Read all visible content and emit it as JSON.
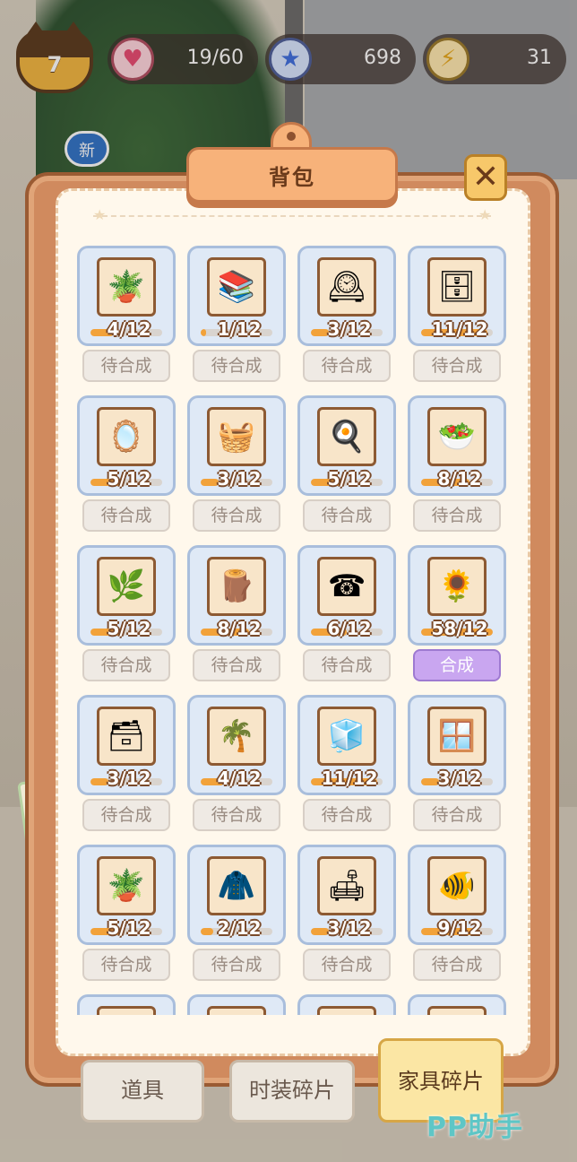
{
  "status": {
    "level": "7",
    "hearts": "19/60",
    "stars": "698",
    "energy": "31"
  },
  "side": {
    "new_badge": "新"
  },
  "panel": {
    "title": "背包",
    "close": "✕"
  },
  "items": [
    {
      "icon": "flower-pot-table",
      "glyph": "🪴",
      "count": "4/12",
      "progress": 0.33,
      "action": "待合成"
    },
    {
      "icon": "bookshelf",
      "glyph": "📚",
      "count": "1/12",
      "progress": 0.08,
      "action": "待合成"
    },
    {
      "icon": "cuckoo-clock",
      "glyph": "🕰",
      "count": "3/12",
      "progress": 0.25,
      "action": "待合成"
    },
    {
      "icon": "side-table",
      "glyph": "🗄",
      "count": "11/12",
      "progress": 0.92,
      "action": "待合成"
    },
    {
      "icon": "arched-mirror",
      "glyph": "🪞",
      "count": "5/12",
      "progress": 0.42,
      "action": "待合成"
    },
    {
      "icon": "wall-shelf",
      "glyph": "🧺",
      "count": "3/12",
      "progress": 0.25,
      "action": "待合成"
    },
    {
      "icon": "stove",
      "glyph": "🍳",
      "count": "5/12",
      "progress": 0.42,
      "action": "待合成"
    },
    {
      "icon": "cutting-board",
      "glyph": "🥗",
      "count": "8/12",
      "progress": 0.67,
      "action": "待合成"
    },
    {
      "icon": "hanging-plant",
      "glyph": "🌿",
      "count": "5/12",
      "progress": 0.42,
      "action": "待合成"
    },
    {
      "icon": "wall-shelf-plank",
      "glyph": "🪵",
      "count": "8/12",
      "progress": 0.67,
      "action": "待合成"
    },
    {
      "icon": "wall-phone",
      "glyph": "☎",
      "count": "6/12",
      "progress": 0.5,
      "action": "待合成"
    },
    {
      "icon": "flower-pot",
      "glyph": "🌻",
      "count": "58/12",
      "progress": 1.0,
      "action": "合成"
    },
    {
      "icon": "nightstand",
      "glyph": "🗃",
      "count": "3/12",
      "progress": 0.25,
      "action": "待合成"
    },
    {
      "icon": "palm-plant",
      "glyph": "🌴",
      "count": "4/12",
      "progress": 0.33,
      "action": "待合成"
    },
    {
      "icon": "refrigerator",
      "glyph": "🧊",
      "count": "11/12",
      "progress": 0.92,
      "action": "待合成"
    },
    {
      "icon": "lattice-screen",
      "glyph": "🪟",
      "count": "3/12",
      "progress": 0.25,
      "action": "待合成"
    },
    {
      "icon": "monstera-plant",
      "glyph": "🪴",
      "count": "5/12",
      "progress": 0.42,
      "action": "待合成"
    },
    {
      "icon": "coat-rack",
      "glyph": "🧥",
      "count": "2/12",
      "progress": 0.17,
      "action": "待合成"
    },
    {
      "icon": "sofa",
      "glyph": "🛋",
      "count": "3/12",
      "progress": 0.25,
      "action": "待合成"
    },
    {
      "icon": "fishbowl-table",
      "glyph": "🐠",
      "count": "9/12",
      "progress": 0.75,
      "action": "待合成"
    },
    {
      "icon": "partial-item-1",
      "glyph": "🌱",
      "count": "",
      "progress": 0,
      "action": ""
    },
    {
      "icon": "partial-item-2",
      "glyph": "🪑",
      "count": "",
      "progress": 0,
      "action": ""
    },
    {
      "icon": "partial-item-3",
      "glyph": "📦",
      "count": "",
      "progress": 0,
      "action": ""
    },
    {
      "icon": "partial-item-4",
      "glyph": "🖼",
      "count": "",
      "progress": 0,
      "action": ""
    }
  ],
  "tabs": {
    "items": "道具",
    "fashion": "时装碎片",
    "furniture": "家具碎片"
  },
  "watermark": "PP助手",
  "colors": {
    "progress": "#f2a23a",
    "card_bg": "#dfe9f6",
    "ready_button": "#c9a6f0",
    "panel_frame": "#d08a5e"
  }
}
